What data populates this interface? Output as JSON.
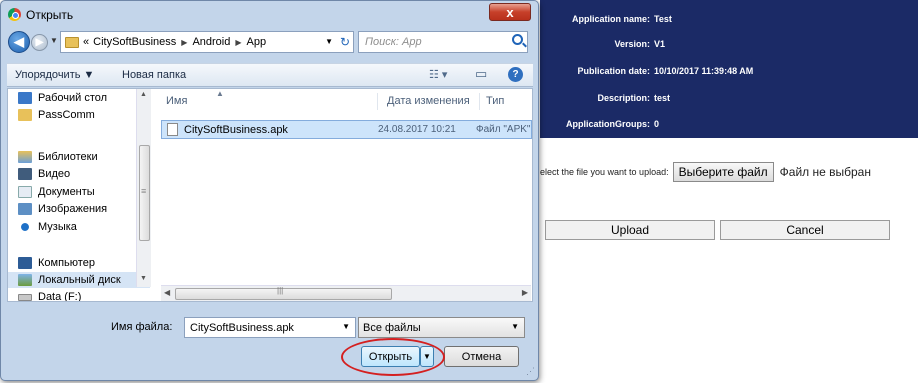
{
  "webpage": {
    "app_info": [
      {
        "label": "Application name:",
        "value": "Test"
      },
      {
        "label": "Version:",
        "value": "V1"
      },
      {
        "label": "Publication date:",
        "value": "10/10/2017 11:39:48 AM"
      },
      {
        "label": "Description:",
        "value": "test"
      },
      {
        "label": "ApplicationGroups:",
        "value": "0"
      }
    ],
    "upload_prompt": "elect the file you want to upload:",
    "choose_file_label": "Выберите файл",
    "no_file_label": "Файл не выбран",
    "upload_button": "Upload",
    "cancel_button": "Cancel",
    "panel_color": "#1b2a66"
  },
  "dialog": {
    "title": "Открыть",
    "close_glyph": "x",
    "breadcrumb": [
      "«",
      "CitySoftBusiness",
      "Android",
      "App"
    ],
    "search_placeholder": "Поиск: App",
    "toolbar": {
      "organize": "Упорядочить ▼",
      "new_folder": "Новая папка"
    },
    "nav_items": [
      {
        "label": "Рабочий стол",
        "icon": "desktop-icon"
      },
      {
        "label": "PassComm",
        "icon": "folder-icon"
      },
      {
        "label": "Библиотеки",
        "icon": "libraries-icon"
      },
      {
        "label": "Видео",
        "icon": "video-icon"
      },
      {
        "label": "Документы",
        "icon": "documents-icon"
      },
      {
        "label": "Изображения",
        "icon": "pictures-icon"
      },
      {
        "label": "Музыка",
        "icon": "music-icon"
      },
      {
        "label": "Компьютер",
        "icon": "computer-icon"
      },
      {
        "label": "Локальный диск",
        "icon": "local-disk-icon"
      },
      {
        "label": "Data (F:)",
        "icon": "drive-icon"
      }
    ],
    "columns": {
      "name": "Имя",
      "date": "Дата изменения",
      "type": "Тип"
    },
    "files": [
      {
        "name": "CitySoftBusiness.apk",
        "date": "24.08.2017 10:21",
        "type": "Файл \"APK\""
      }
    ],
    "filename_label": "Имя файла:",
    "filename_value": "CitySoftBusiness.apk",
    "filter_value": "Все файлы",
    "open_button": "Открыть",
    "cancel_button": "Отмена",
    "highlight_color": "#d42020"
  }
}
